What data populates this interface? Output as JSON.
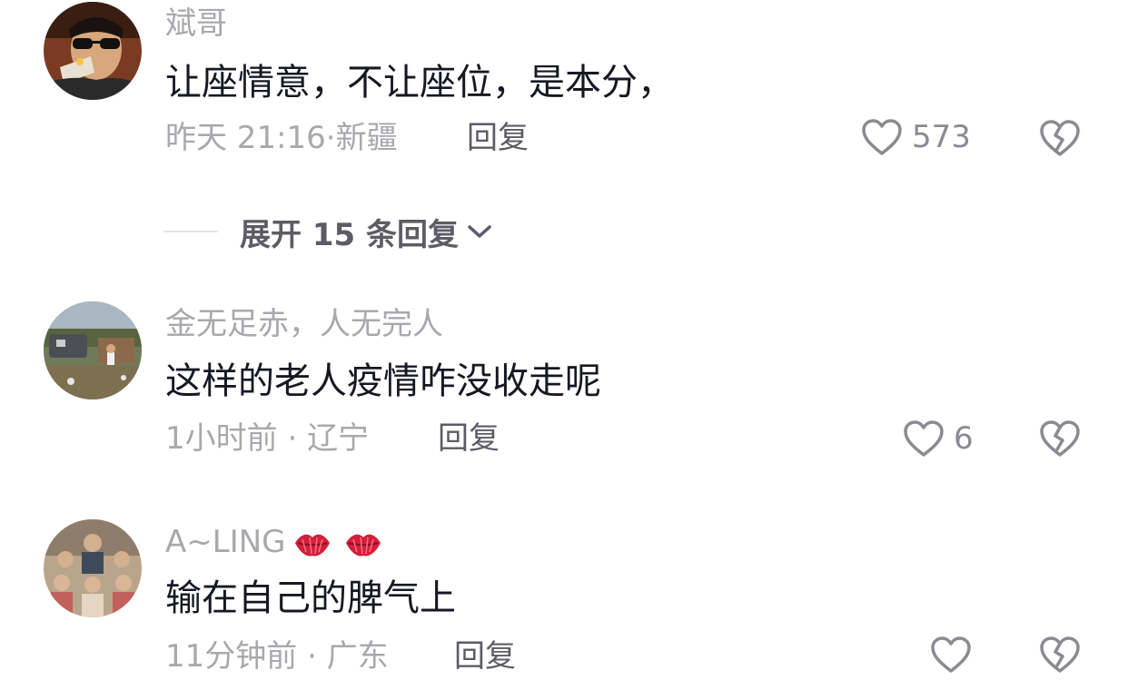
{
  "comments": [
    {
      "username": "斌哥",
      "text": "让座情意，不让座位，是本分，",
      "time": "昨天 21:16",
      "location": "新疆",
      "reply_label": "回复",
      "like_count": "573"
    },
    {
      "username": "金无足赤，人无完人",
      "text": "这样的老人疫情咋没收走呢",
      "time": "1小时前",
      "location": "辽宁",
      "reply_label": "回复",
      "like_count": "6"
    },
    {
      "username": "A~LING",
      "username_emoji": [
        "kiss-lips",
        "kiss-lips"
      ],
      "text": "输在自己的脾气上",
      "time": "11分钟前",
      "location": "广东",
      "reply_label": "回复",
      "like_count": ""
    }
  ],
  "expand_replies": {
    "label": "展开 15 条回复"
  },
  "colors": {
    "username": "#a8a8ad",
    "text": "#161823",
    "meta": "#a8a8ad",
    "reply": "#5c5c66",
    "icon": "#8a8a91"
  },
  "icons": {
    "like": "heart-outline-icon",
    "dislike": "broken-heart-icon",
    "expand": "chevron-down-icon"
  }
}
